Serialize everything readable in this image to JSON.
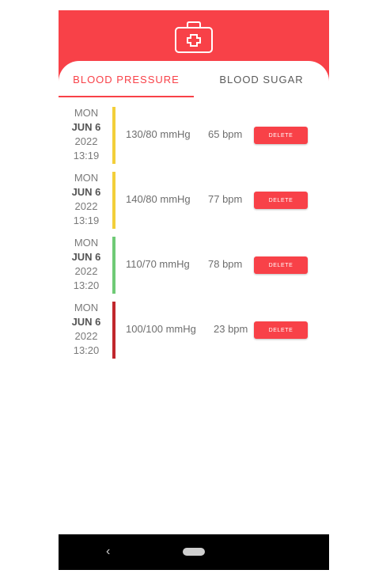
{
  "colors": {
    "accent": "#f84148",
    "bar_yellow": "#f3cf3a",
    "bar_green": "#6fca76",
    "bar_red": "#c1272d"
  },
  "header": {
    "icon": "first-aid-kit-icon"
  },
  "tabs": [
    {
      "label": "BLOOD PRESSURE",
      "active": true
    },
    {
      "label": "BLOOD SUGAR",
      "active": false
    }
  ],
  "entries": [
    {
      "weekday": "MON",
      "day": "JUN 6",
      "year": "2022",
      "time": "13:19",
      "pressure": "130/80 mmHg",
      "pulse": "65 bpm",
      "status_color": "#f3cf3a",
      "delete_label": "DELETE"
    },
    {
      "weekday": "MON",
      "day": "JUN 6",
      "year": "2022",
      "time": "13:19",
      "pressure": "140/80 mmHg",
      "pulse": "77 bpm",
      "status_color": "#f3cf3a",
      "delete_label": "DELETE"
    },
    {
      "weekday": "MON",
      "day": "JUN 6",
      "year": "2022",
      "time": "13:20",
      "pressure": "110/70 mmHg",
      "pulse": "78 bpm",
      "status_color": "#6fca76",
      "delete_label": "DELETE"
    },
    {
      "weekday": "MON",
      "day": "JUN 6",
      "year": "2022",
      "time": "13:20",
      "pressure": "100/100 mmHg",
      "pulse": "23 bpm",
      "status_color": "#c1272d",
      "delete_label": "DELETE"
    }
  ],
  "navbar": {
    "back_icon": "back-chevron-icon",
    "home_icon": "home-pill-icon"
  }
}
